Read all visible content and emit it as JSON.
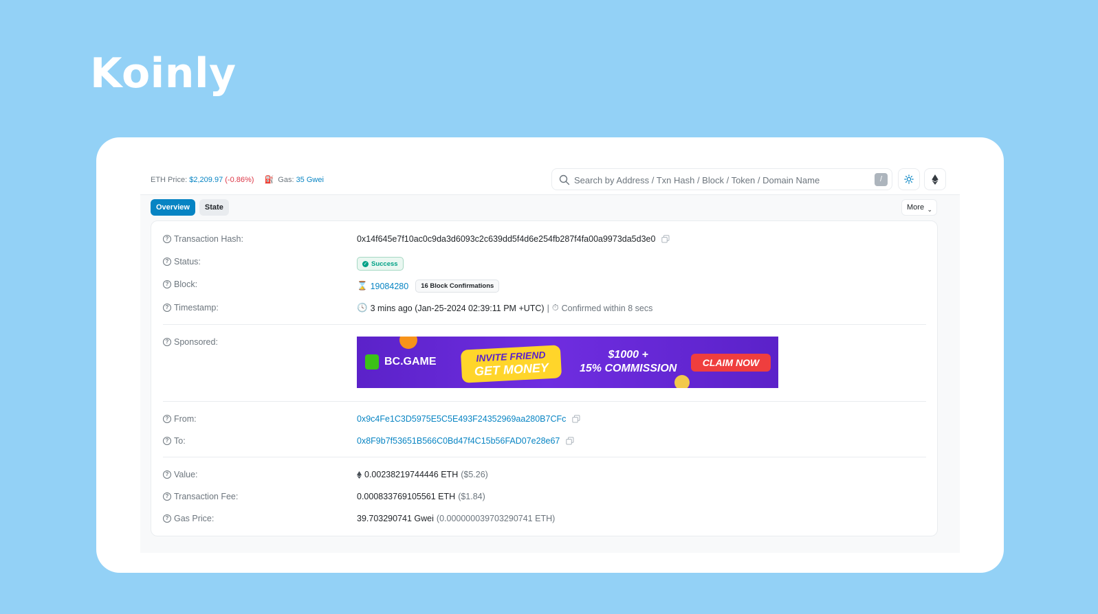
{
  "brand": {
    "name": "Koinly"
  },
  "topbar": {
    "eth_price_label": "ETH Price:",
    "eth_price": "$2,209.97",
    "eth_change": "(-0.86%)",
    "gas_label": "Gas:",
    "gas_value": "35 Gwei",
    "search_placeholder": "Search by Address / Txn Hash / Block / Token / Domain Name",
    "search_shortcut": "/",
    "theme_icon": "sun-icon",
    "network_icon": "ethereum-icon"
  },
  "tabs": [
    {
      "label": "Overview",
      "active": true
    },
    {
      "label": "State",
      "active": false
    }
  ],
  "more_label": "More",
  "details": {
    "tx_hash": {
      "label": "Transaction Hash:",
      "value": "0x14f645e7f10ac0c9da3d6093c2c639dd5f4d6e254fb287f4fa00a9973da5d3e0"
    },
    "status": {
      "label": "Status:",
      "value": "Success"
    },
    "block": {
      "label": "Block:",
      "value": "19084280",
      "confirmations": "16 Block Confirmations"
    },
    "timestamp": {
      "label": "Timestamp:",
      "value": "3 mins ago (Jan-25-2024 02:39:11 PM +UTC)",
      "separator": "|",
      "confirmed": "Confirmed within 8 secs"
    },
    "sponsored": {
      "label": "Sponsored:"
    },
    "from": {
      "label": "From:",
      "value": "0x9c4Fe1C3D5975E5C5E493F24352969aa280B7CFc"
    },
    "to": {
      "label": "To:",
      "value": "0x8F9b7f53651B566C0Bd47f4C15b56FAD07e28e67"
    },
    "value": {
      "label": "Value:",
      "amount": "0.00238219744446 ETH",
      "usd": "($5.26)"
    },
    "fee": {
      "label": "Transaction Fee:",
      "amount": "0.000833769105561 ETH",
      "usd": "($1.84)"
    },
    "gas_price": {
      "label": "Gas Price:",
      "amount": "39.703290741 Gwei",
      "eth": "(0.000000039703290741 ETH)"
    }
  },
  "ad": {
    "brand": "BC.GAME",
    "line1": "INVITE FRIEND",
    "line2": "GET MONEY",
    "offer1": "$1000 +",
    "offer2": "15% COMMISSION",
    "cta": "CLAIM NOW"
  }
}
